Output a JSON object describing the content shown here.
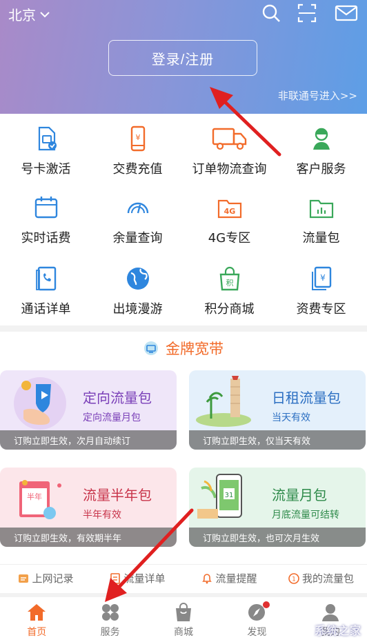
{
  "header": {
    "city": "北京",
    "login_label": "登录/注册",
    "non_unicom_link": "非联通号进入>>",
    "icons": [
      "search-icon",
      "scan-icon",
      "mail-icon"
    ]
  },
  "services": [
    {
      "label": "号卡激活",
      "icon": "sim-card-icon"
    },
    {
      "label": "交费充值",
      "icon": "phone-payment-icon"
    },
    {
      "label": "订单物流查询",
      "icon": "truck-icon"
    },
    {
      "label": "客户服务",
      "icon": "customer-service-icon"
    },
    {
      "label": "实时话费",
      "icon": "calendar-icon"
    },
    {
      "label": "余量查询",
      "icon": "gauge-icon"
    },
    {
      "label": "4G专区",
      "icon": "4g-folder-icon"
    },
    {
      "label": "流量包",
      "icon": "data-folder-icon"
    },
    {
      "label": "通话详单",
      "icon": "call-log-icon"
    },
    {
      "label": "出境漫游",
      "icon": "globe-icon"
    },
    {
      "label": "积分商城",
      "icon": "points-bag-icon"
    },
    {
      "label": "资费专区",
      "icon": "tariff-icon"
    }
  ],
  "banner": {
    "title": "金牌宽带",
    "cards": [
      {
        "title": "定向流量包",
        "subtitle": "定向流量月包",
        "note": "订购立即生效，次月自动续订",
        "bg": "#efe6f9",
        "title_color": "#7a3fb8"
      },
      {
        "title": "日租流量包",
        "subtitle": "当天有效",
        "note": "订购立即生效，仅当天有效",
        "bg": "#e4f0fb",
        "title_color": "#2c6fc2"
      },
      {
        "title": "流量半年包",
        "subtitle": "半年有效",
        "note": "订购立即生效，有效期半年",
        "bg": "#fce6ea",
        "title_color": "#c8344a"
      },
      {
        "title": "流量月包",
        "subtitle": "月底流量可结转",
        "note": "订购立即生效，也可次月生效",
        "bg": "#e5f5ea",
        "title_color": "#2e8a4a"
      }
    ]
  },
  "quick_links": [
    {
      "label": "上网记录",
      "icon": "record-icon"
    },
    {
      "label": "流量详单",
      "icon": "detail-list-icon"
    },
    {
      "label": "流量提醒",
      "icon": "bell-icon"
    },
    {
      "label": "我的流量包",
      "icon": "my-package-icon"
    }
  ],
  "bottom_nav": [
    {
      "label": "首页",
      "icon": "home-icon",
      "active": true
    },
    {
      "label": "服务",
      "icon": "grid-icon",
      "active": false
    },
    {
      "label": "商城",
      "icon": "shopping-bag-icon",
      "active": false
    },
    {
      "label": "发现",
      "icon": "discover-icon",
      "active": false
    },
    {
      "label": "我的",
      "icon": "profile-icon",
      "active": false
    }
  ],
  "watermark": "系统之家",
  "colors": {
    "accent": "#f26b2a",
    "header_start": "#a98ac8",
    "header_end": "#5d9ee6",
    "annotation_arrow": "#e02020"
  }
}
